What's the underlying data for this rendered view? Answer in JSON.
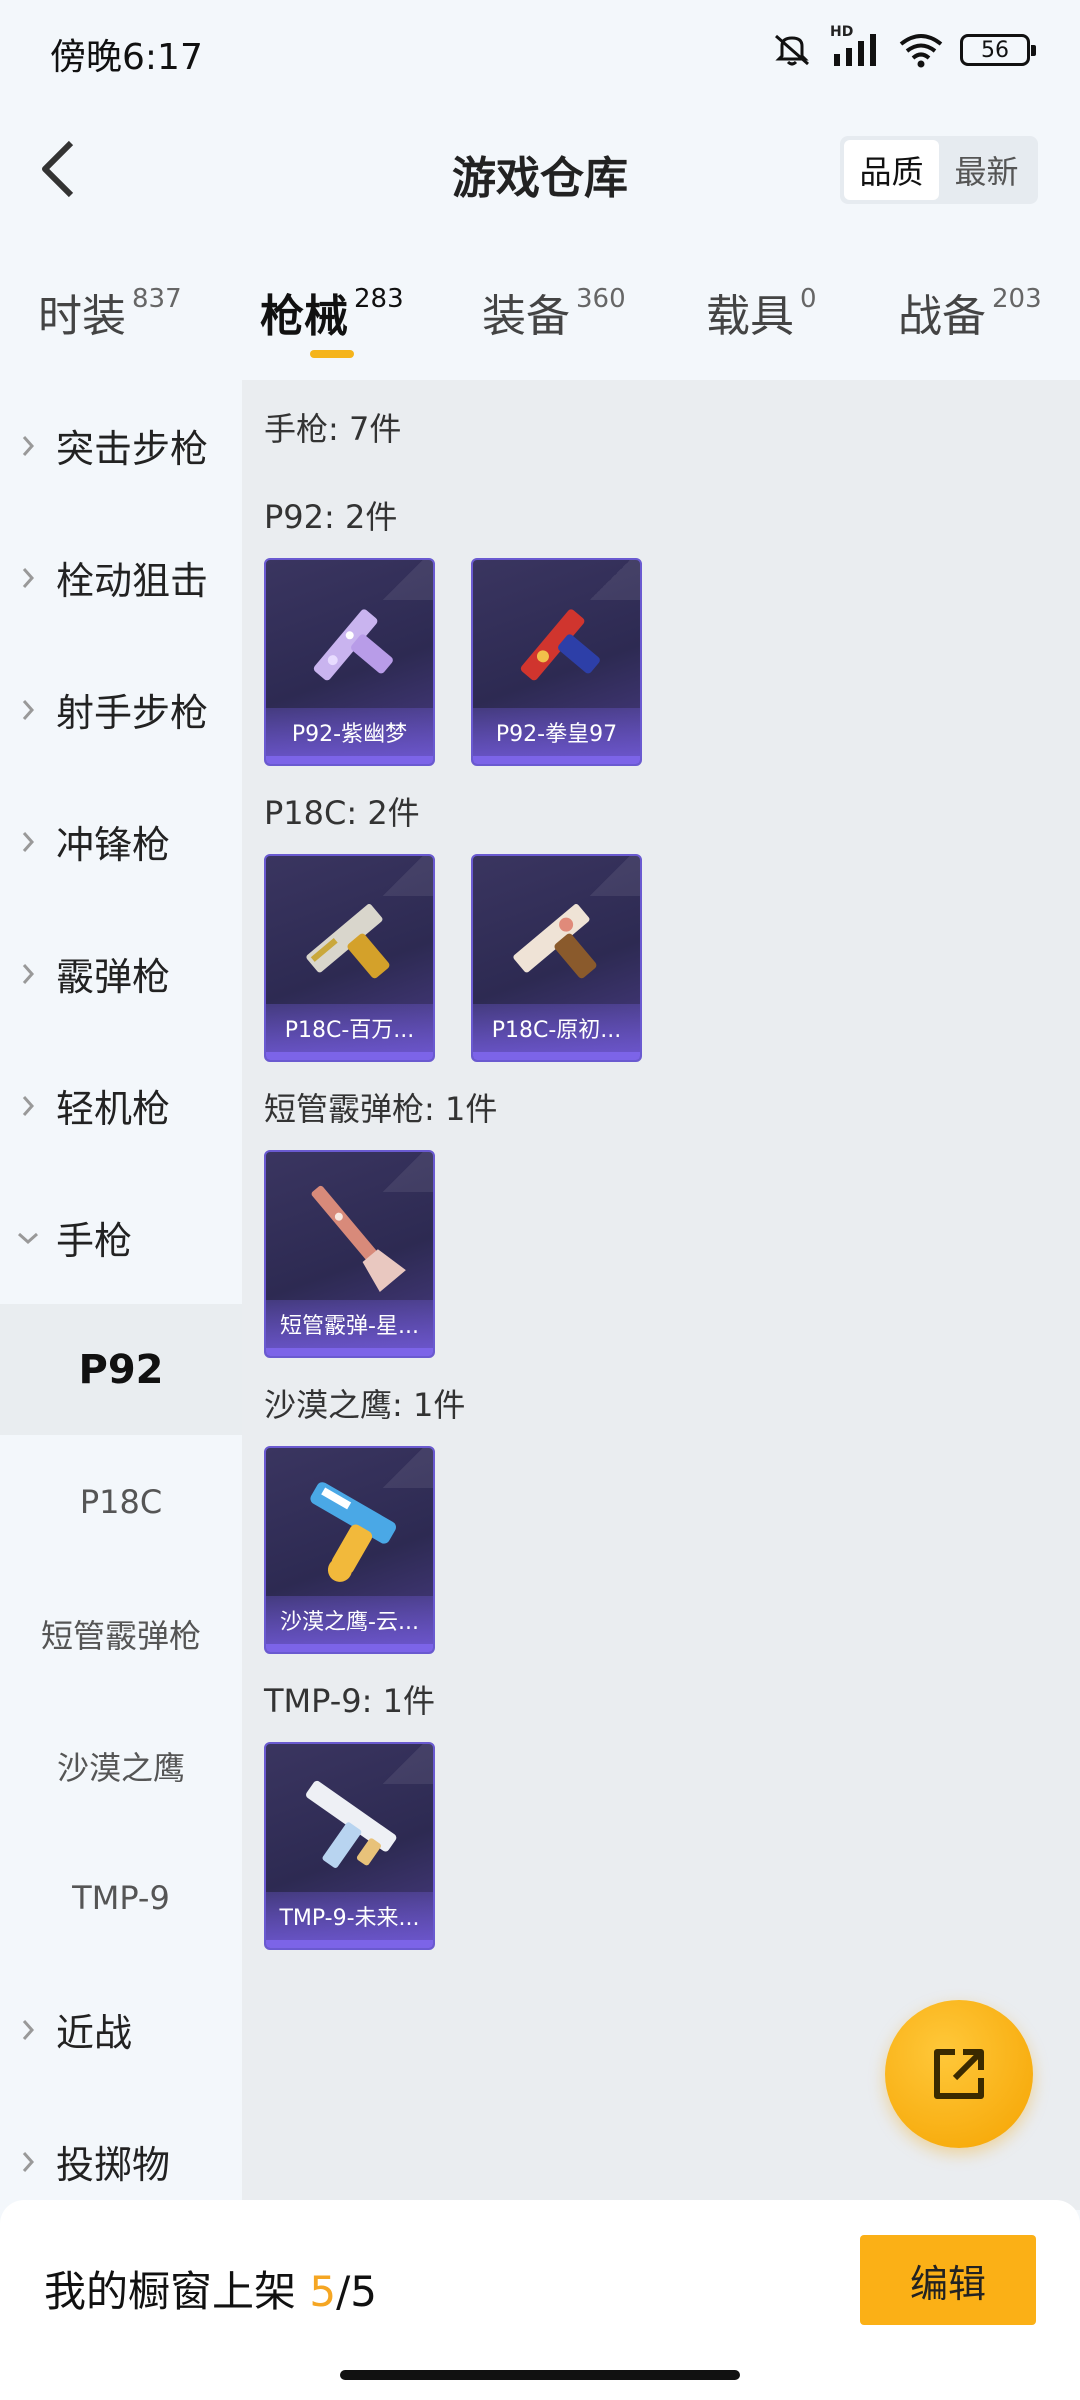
{
  "status_bar": {
    "time": "傍晚6:17",
    "network": "HD",
    "battery": "56",
    "icons": [
      "mute-icon",
      "signal-icon",
      "wifi-icon",
      "battery-icon"
    ]
  },
  "header": {
    "title": "游戏仓库",
    "sort_options": [
      {
        "label": "品质",
        "active": true
      },
      {
        "label": "最新",
        "active": false
      }
    ]
  },
  "tabs": [
    {
      "label": "时装",
      "count": "837",
      "active": false
    },
    {
      "label": "枪械",
      "count": "283",
      "active": true
    },
    {
      "label": "装备",
      "count": "360",
      "active": false
    },
    {
      "label": "载具",
      "count": "0",
      "active": false
    },
    {
      "label": "战备",
      "count": "203",
      "active": false
    }
  ],
  "sidebar": {
    "categories": [
      {
        "label": "突击步枪",
        "expanded": false
      },
      {
        "label": "栓动狙击",
        "expanded": false
      },
      {
        "label": "射手步枪",
        "expanded": false
      },
      {
        "label": "冲锋枪",
        "expanded": false
      },
      {
        "label": "霰弹枪",
        "expanded": false
      },
      {
        "label": "轻机枪",
        "expanded": false
      },
      {
        "label": "手枪",
        "expanded": true
      }
    ],
    "subitems": [
      {
        "label": "P92",
        "active": true
      },
      {
        "label": "P18C",
        "active": false
      },
      {
        "label": "短管霰弹枪",
        "active": false
      },
      {
        "label": "沙漠之鹰",
        "active": false
      },
      {
        "label": "TMP-9",
        "active": false
      }
    ],
    "after": [
      {
        "label": "近战",
        "expanded": false
      },
      {
        "label": "投掷物",
        "expanded": false
      }
    ]
  },
  "content": {
    "total": "手枪: 7件",
    "groups": [
      {
        "title": "P92: 2件",
        "items": [
          "P92-紫幽梦",
          "P92-拳皇97"
        ]
      },
      {
        "title": "P18C: 2件",
        "items": [
          "P18C-百万...",
          "P18C-原初..."
        ]
      },
      {
        "title": "短管霰弹枪: 1件",
        "items": [
          "短管霰弹-星..."
        ]
      },
      {
        "title": "沙漠之鹰: 1件",
        "items": [
          "沙漠之鹰-云..."
        ]
      },
      {
        "title": "TMP-9: 1件",
        "items": [
          "TMP-9-未来..."
        ]
      }
    ]
  },
  "bottom": {
    "showcase_label": "我的橱窗上架",
    "showcase_count": "5",
    "showcase_total": "/5",
    "edit_label": "编辑"
  },
  "colors": {
    "accent": "#f5b41b",
    "edit_button": "#fbb016",
    "card_border": "#6a5ad0"
  }
}
